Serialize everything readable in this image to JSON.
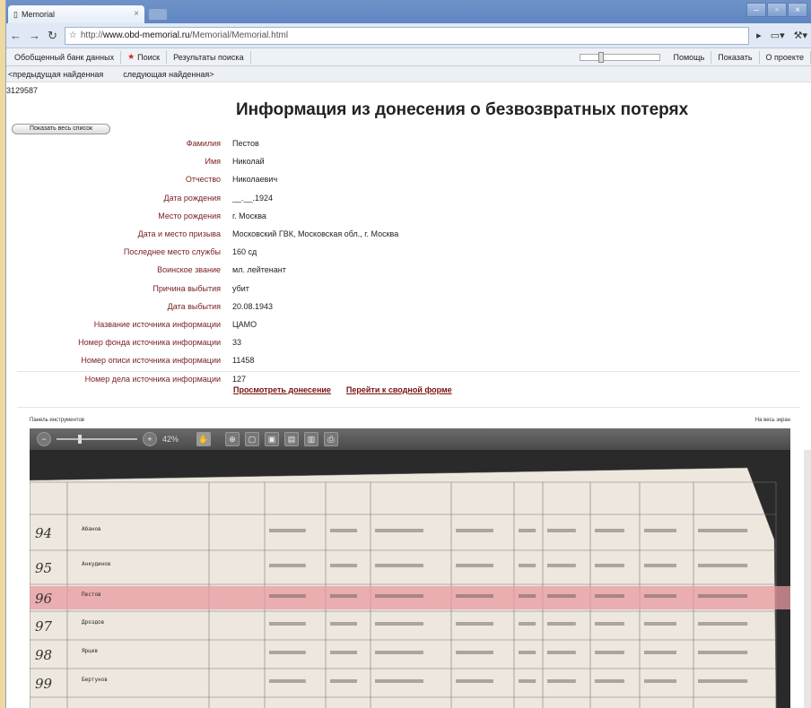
{
  "browser": {
    "tab_title": "Memorial",
    "url_prefix": "http://",
    "url_domain": "www.obd-memorial.ru",
    "url_path": "/Memorial/Memorial.html"
  },
  "menu": {
    "items": [
      "Обобщенный банк данных",
      "Поиск",
      "Результаты поиска"
    ],
    "right_items": [
      "Помощь",
      "Показать",
      "О проекте"
    ]
  },
  "nav": {
    "prev": "<предыдущая найденная",
    "next": "следующая найденная>"
  },
  "record_id": "3129587",
  "page_title": "Информация из донесения о безвозвратных потерях",
  "show_all_button": "Показать весь список",
  "fields": [
    {
      "label": "Фамилия",
      "value": "Пестов"
    },
    {
      "label": "Имя",
      "value": "Николай"
    },
    {
      "label": "Отчество",
      "value": "Николаевич"
    },
    {
      "label": "Дата рождения",
      "value": "__.__.1924"
    },
    {
      "label": "Место рождения",
      "value": "г. Москва"
    },
    {
      "label": "Дата и место призыва",
      "value": "Московский ГВК, Московская обл., г. Москва"
    },
    {
      "label": "Последнее место службы",
      "value": "160 сд"
    },
    {
      "label": "Воинское звание",
      "value": "мл. лейтенант"
    },
    {
      "label": "Причина выбытия",
      "value": "убит"
    },
    {
      "label": "Дата выбытия",
      "value": "20.08.1943"
    },
    {
      "label": "Название источника информации",
      "value": "ЦАМО"
    },
    {
      "label": "Номер фонда источника информации",
      "value": "33"
    },
    {
      "label": "Номер описи источника информации",
      "value": "11458"
    },
    {
      "label": "Номер дела источника информации",
      "value": "127"
    }
  ],
  "links": {
    "view_report": "Просмотреть донесение",
    "go_card": "Перейти к сводной форме"
  },
  "viewer": {
    "top_left": "Панель инструментов",
    "top_right": "На весь экран",
    "zoom": "42%"
  },
  "document_rows": [
    {
      "num": "94",
      "name": "Абанов",
      "marked": false
    },
    {
      "num": "95",
      "name": "Анкудинов",
      "marked": false
    },
    {
      "num": "96",
      "name": "Пестов",
      "marked": true
    },
    {
      "num": "97",
      "name": "Дроздов",
      "marked": false
    },
    {
      "num": "98",
      "name": "Ярцев",
      "marked": false
    },
    {
      "num": "99",
      "name": "Бертунов",
      "marked": false
    }
  ],
  "colors": {
    "label": "#7a1c1c",
    "highlight": "#e89aa0",
    "toolbar": "#555555"
  }
}
